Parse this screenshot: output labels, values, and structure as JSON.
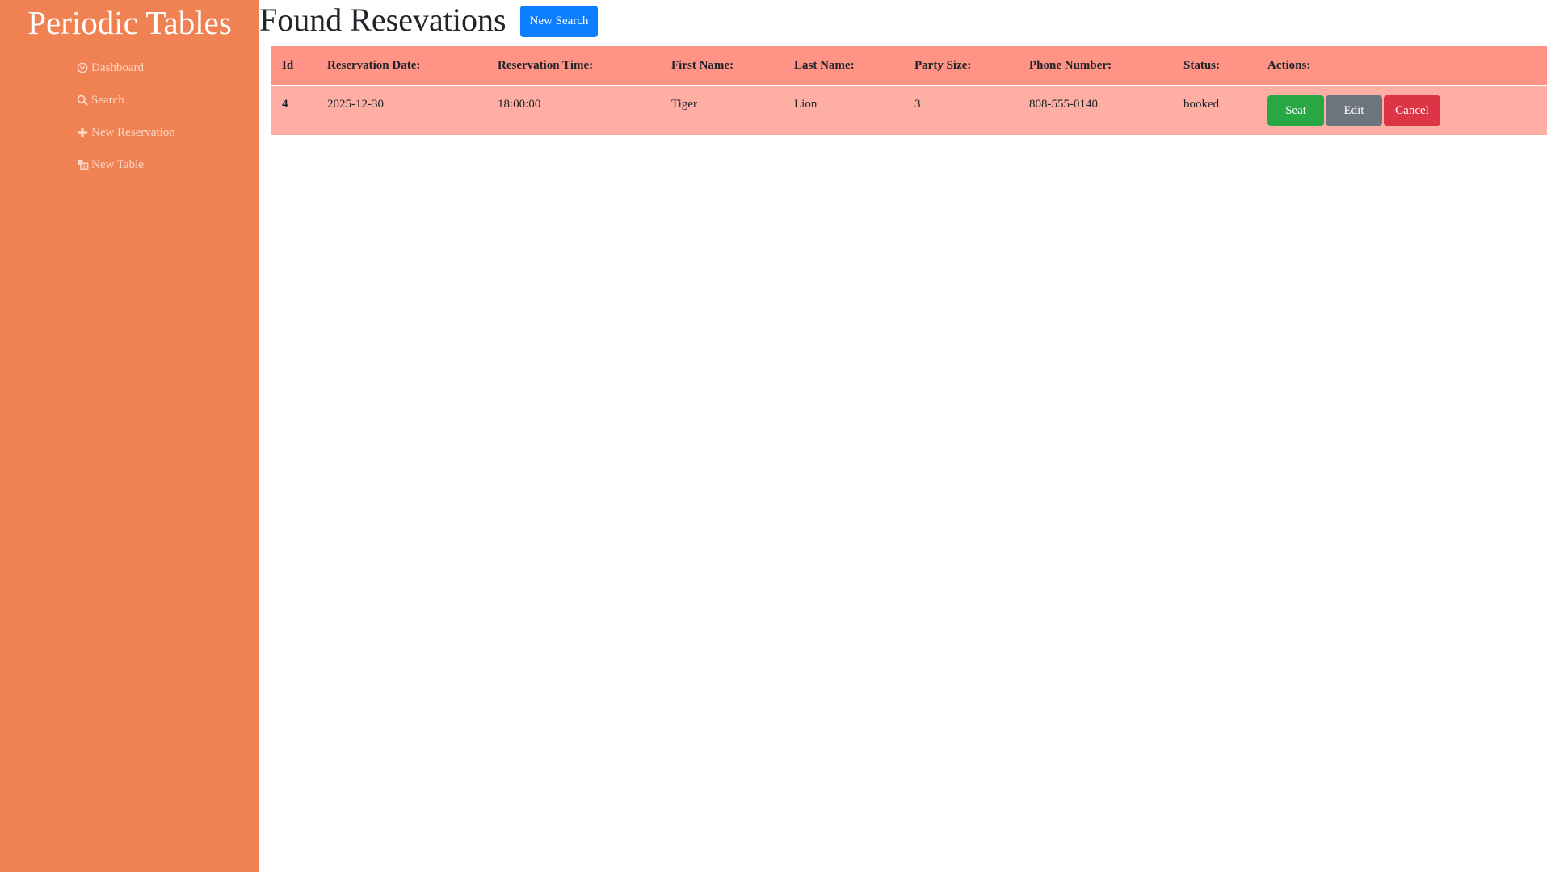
{
  "app": {
    "brand": "Periodic Tables",
    "colors": {
      "sidebar": "#f08152",
      "sidebar_text": "#fbd7c6",
      "primary": "#0d7eff",
      "success": "#28a745",
      "secondary": "#6c757d",
      "danger": "#dc3545",
      "table_header": "#fe9386",
      "table_row": "#ffaea3"
    }
  },
  "sidebar": {
    "items": [
      {
        "label": "Dashboard",
        "icon": "dashboard-icon"
      },
      {
        "label": "Search",
        "icon": "search-icon"
      },
      {
        "label": "New Reservation",
        "icon": "plus-icon"
      },
      {
        "label": "New Table",
        "icon": "table-icon"
      }
    ]
  },
  "header": {
    "title": "Found Resevations",
    "new_search_label": "New Search"
  },
  "table": {
    "columns": [
      "Id",
      "Reservation Date:",
      "Reservation Time:",
      "First Name:",
      "Last Name:",
      "Party Size:",
      "Phone Number:",
      "Status:",
      "Actions:"
    ],
    "rows": [
      {
        "id": "4",
        "reservation_date": "2025-12-30",
        "reservation_time": "18:00:00",
        "first_name": "Tiger",
        "last_name": "Lion",
        "party_size": "3",
        "phone_number": "808-555-0140",
        "status": "booked",
        "actions": {
          "seat": "Seat",
          "edit": "Edit",
          "cancel": "Cancel"
        }
      }
    ]
  }
}
